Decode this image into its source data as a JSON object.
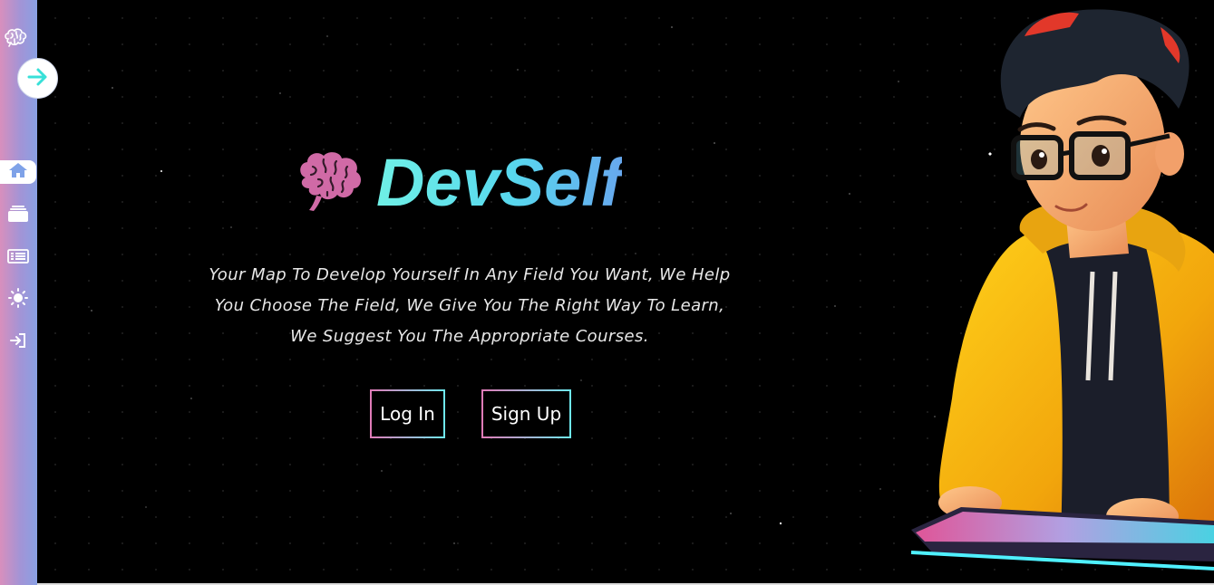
{
  "brand": {
    "name": "DevSelf",
    "logo_icon": "brain-icon"
  },
  "sidebar": {
    "logo_icon": "brain-icon",
    "toggle_icon": "arrow-right-icon",
    "items": [
      {
        "icon": "home-icon",
        "active": true
      },
      {
        "icon": "folders-icon",
        "active": false
      },
      {
        "icon": "list-icon",
        "active": false
      },
      {
        "icon": "sun-icon",
        "active": false
      },
      {
        "icon": "sign-in-icon",
        "active": false
      }
    ]
  },
  "hero": {
    "tagline_lines": [
      "Your Map To Develop Yourself In Any Field You Want, We Help",
      "You Choose The Field, We Give You The Right Way To Learn,",
      "We Suggest You The Appropriate Courses."
    ],
    "login_label": "Log In",
    "signup_label": "Sign Up",
    "illustration": "boy-with-glasses-typing-on-keyboard"
  },
  "colors": {
    "sidebar_pink": "#d88fbd",
    "sidebar_blue": "#8aa0e3",
    "title_cyan": "#58d8ee",
    "brain_pink": "#d06aa6",
    "button_border_pink": "#e07bb8",
    "button_border_cyan": "#6ee8ee",
    "toggle_arrow": "#38e0d8"
  }
}
